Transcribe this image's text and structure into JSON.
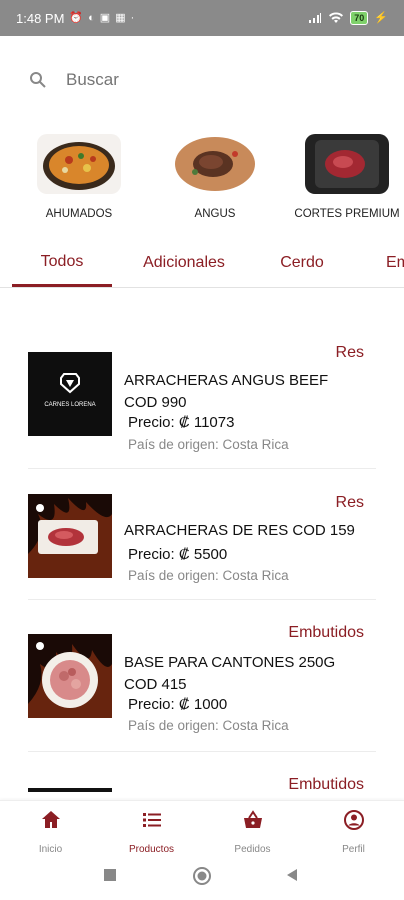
{
  "status_bar": {
    "time": "1:48 PM",
    "battery": "70"
  },
  "search": {
    "placeholder": "Buscar"
  },
  "categories": [
    {
      "label": "AHUMADOS"
    },
    {
      "label": "ANGUS"
    },
    {
      "label": "CORTES PREMIUM"
    }
  ],
  "tabs": [
    {
      "label": "Todos"
    },
    {
      "label": "Adicionales"
    },
    {
      "label": "Cerdo"
    },
    {
      "label": "Em"
    }
  ],
  "products": [
    {
      "category": "Res",
      "name": "ARRACHERAS ANGUS BEEF COD 990",
      "price": "Precio: ₡ 11073",
      "origin": "País de origen: Costa Rica",
      "logo_text": "CARNES LORENA"
    },
    {
      "category": "Res",
      "name": "ARRACHERAS DE RES COD 159",
      "price": "Precio: ₡ 5500",
      "origin": "País de origen: Costa Rica"
    },
    {
      "category": "Embutidos",
      "name": "BASE PARA CANTONES 250G COD 415",
      "price": "Precio: ₡ 1000",
      "origin": "País de origen: Costa Rica"
    },
    {
      "category": "Embutidos"
    }
  ],
  "bottom_nav": [
    {
      "label": "Inicio",
      "icon": "home-icon"
    },
    {
      "label": "Productos",
      "icon": "list-icon"
    },
    {
      "label": "Pedidos",
      "icon": "basket-icon"
    },
    {
      "label": "Perfil",
      "icon": "profile-icon"
    }
  ],
  "colors": {
    "accent": "#8b1e24",
    "status_bar": "#8a8a8a",
    "muted_text": "#888888"
  }
}
